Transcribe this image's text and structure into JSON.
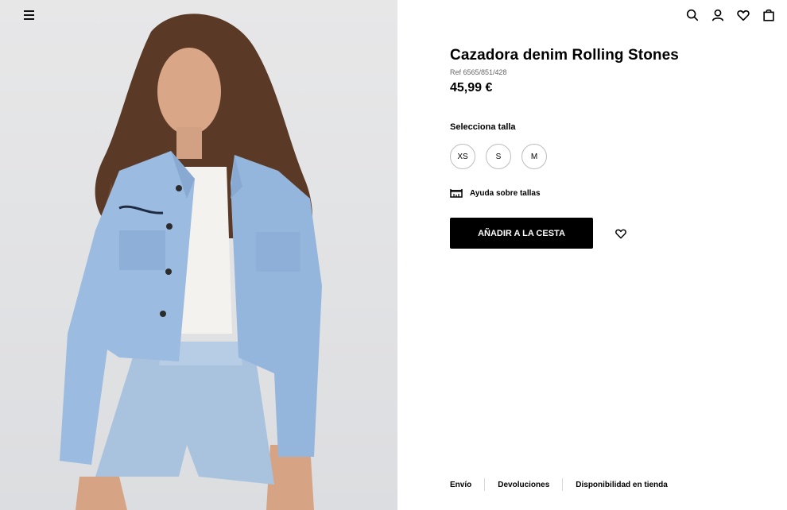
{
  "product": {
    "title": "Cazadora denim Rolling Stones",
    "ref": "Ref 6565/851/428",
    "price": "45,99 €",
    "size_label": "Selecciona talla",
    "sizes": [
      "XS",
      "S",
      "M"
    ],
    "size_help": "Ayuda sobre tallas",
    "add_to_cart": "AÑADIR A LA CESTA"
  },
  "footer": {
    "links": [
      "Envío",
      "Devoluciones",
      "Disponibilidad en tienda"
    ]
  },
  "header_icons": [
    "search-icon",
    "user-icon",
    "heart-icon",
    "bag-icon"
  ],
  "colors": {
    "accent": "#000000",
    "photo_background": "#e2e3e5",
    "denim": "#9bbbe0"
  }
}
